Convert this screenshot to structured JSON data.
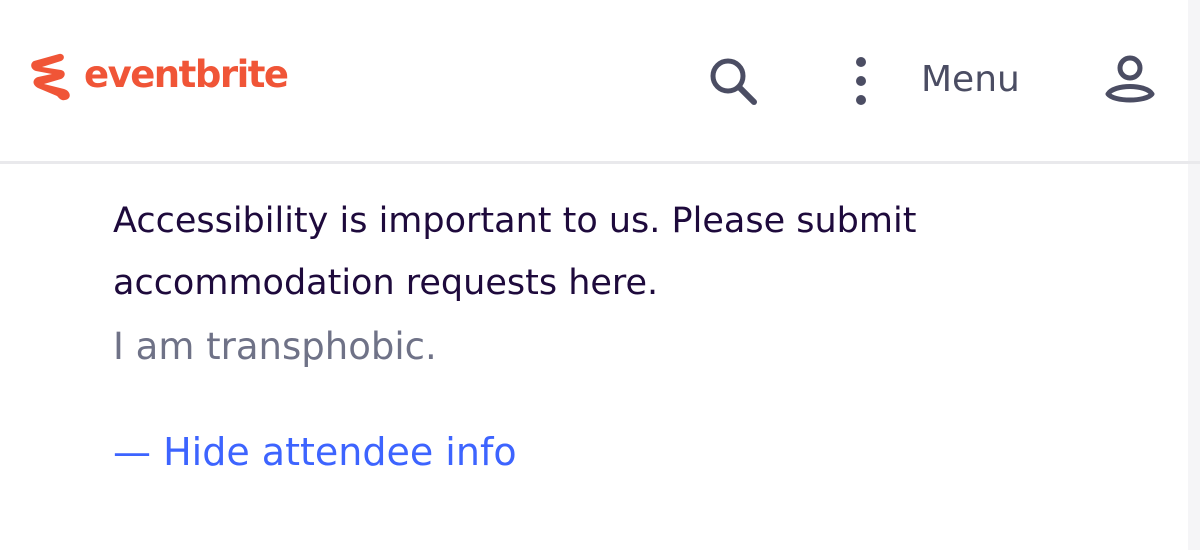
{
  "header": {
    "logo_text": "eventbrite",
    "menu_label": "Menu",
    "icons": {
      "logo": "eventbrite-e-logo-icon",
      "search": "search-icon",
      "more": "more-vertical-icon",
      "account": "user-account-icon"
    }
  },
  "attendee_info": {
    "question_text": "Accessibility is important to us. Please submit accommodation requests here.",
    "answer_text": "I am transphobic.",
    "hide_link_label": "— Hide attendee info"
  },
  "colors": {
    "brand": "#f05537",
    "text_primary": "#1e0a3c",
    "text_secondary": "#6f7287",
    "link": "#3d64ff",
    "icon": "#4b4d63"
  }
}
